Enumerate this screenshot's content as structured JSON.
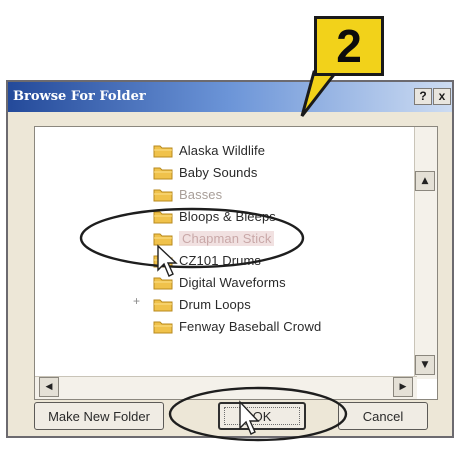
{
  "step": {
    "number": "2"
  },
  "dialog": {
    "title": "Browse For Folder",
    "help_button": "?",
    "close_button": "x"
  },
  "tree": {
    "items": [
      {
        "label": "Alaska Wildlife",
        "state": "normal"
      },
      {
        "label": "Baby Sounds",
        "state": "normal"
      },
      {
        "label": "Basses",
        "state": "faded"
      },
      {
        "label": "Bloops & Bleeps",
        "state": "normal"
      },
      {
        "label": "Chapman Stick",
        "state": "highlighted"
      },
      {
        "label": "CZ101 Drums",
        "state": "normal"
      },
      {
        "label": "Digital Waveforms",
        "state": "normal"
      },
      {
        "label": "Drum Loops",
        "state": "normal"
      },
      {
        "label": "Fenway Baseball Crowd",
        "state": "normal"
      }
    ],
    "expand_marker": "+"
  },
  "buttons": {
    "new_folder": "Make New Folder",
    "ok": "OK",
    "cancel": "Cancel"
  },
  "colors": {
    "callout": "#f2d21a",
    "folder": "#f0c24b",
    "titlebar": "#244a9a"
  }
}
